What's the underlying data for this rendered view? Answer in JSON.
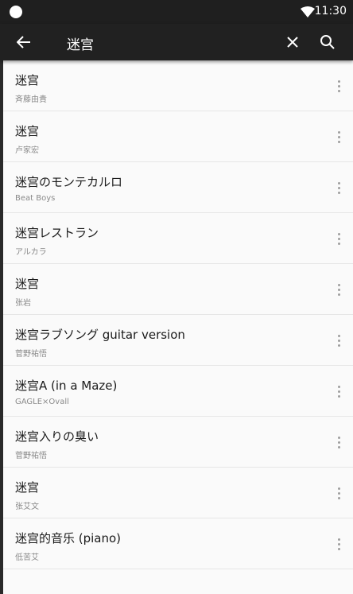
{
  "status_bar": {
    "time": "11:30",
    "icons": [
      "notification-dot-icon",
      "wifi-icon"
    ]
  },
  "toolbar": {
    "query": "迷宫",
    "icons": [
      "arrow-back-icon",
      "close-icon",
      "search-icon"
    ]
  },
  "colors": {
    "toolbar_bg": "#212121",
    "status_bar_bg": "#1f1f1f",
    "list_bg": "#fafafa",
    "title_text": "#1a1a1a",
    "artist_text": "#8a8a8a"
  },
  "results": [
    {
      "title": "迷宫",
      "artist": "斉藤由貴"
    },
    {
      "title": "迷宫",
      "artist": "卢家宏"
    },
    {
      "title": "迷宫のモンテカルロ",
      "artist": "Beat Boys"
    },
    {
      "title": "迷宫レストラン",
      "artist": "アルカラ"
    },
    {
      "title": "迷宫",
      "artist": "张岩"
    },
    {
      "title": "迷宫ラブソング guitar version",
      "artist": "菅野祐悟"
    },
    {
      "title": "迷宫A (in a Maze)",
      "artist": "GAGLE×Ovall"
    },
    {
      "title": "迷宫入りの臭い",
      "artist": "菅野祐悟"
    },
    {
      "title": "迷宫",
      "artist": "张艾文"
    },
    {
      "title": "迷宫的音乐 (piano)",
      "artist": "低苦艾"
    }
  ]
}
